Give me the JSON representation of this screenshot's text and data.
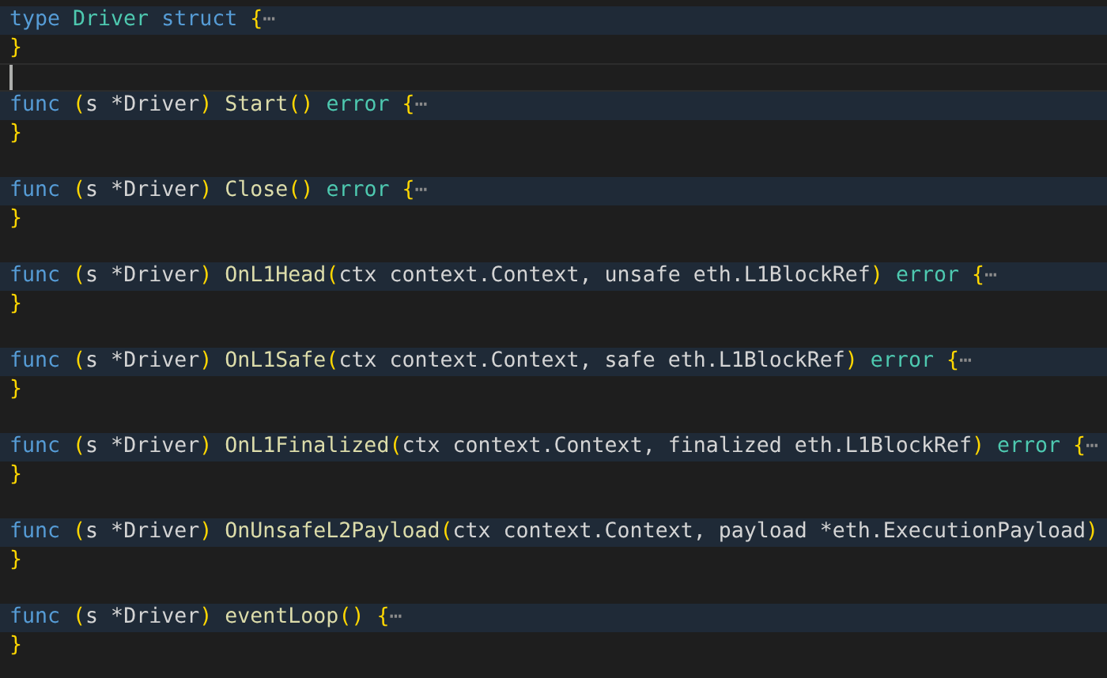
{
  "lines": [
    {
      "folded": true,
      "tokens": [
        {
          "kind": "keyword",
          "text": "type "
        },
        {
          "kind": "type",
          "text": "Driver "
        },
        {
          "kind": "keyword",
          "text": "struct "
        },
        {
          "kind": "bracket",
          "text": "{"
        },
        {
          "kind": "fold",
          "text": "⋯"
        }
      ]
    },
    {
      "folded": false,
      "tokens": [
        {
          "kind": "bracket",
          "text": "}"
        }
      ]
    },
    {
      "folded": false,
      "cursor": true
    },
    {
      "folded": true,
      "tokens": [
        {
          "kind": "keyword",
          "text": "func "
        },
        {
          "kind": "bracket",
          "text": "("
        },
        {
          "kind": "plain",
          "text": "s *Driver"
        },
        {
          "kind": "bracket",
          "text": ") "
        },
        {
          "kind": "func",
          "text": "Start"
        },
        {
          "kind": "bracket",
          "text": "() "
        },
        {
          "kind": "type",
          "text": "error "
        },
        {
          "kind": "bracket",
          "text": "{"
        },
        {
          "kind": "fold",
          "text": "⋯"
        }
      ]
    },
    {
      "folded": false,
      "tokens": [
        {
          "kind": "bracket",
          "text": "}"
        }
      ]
    },
    {
      "folded": false
    },
    {
      "folded": true,
      "tokens": [
        {
          "kind": "keyword",
          "text": "func "
        },
        {
          "kind": "bracket",
          "text": "("
        },
        {
          "kind": "plain",
          "text": "s *Driver"
        },
        {
          "kind": "bracket",
          "text": ") "
        },
        {
          "kind": "func",
          "text": "Close"
        },
        {
          "kind": "bracket",
          "text": "() "
        },
        {
          "kind": "type",
          "text": "error "
        },
        {
          "kind": "bracket",
          "text": "{"
        },
        {
          "kind": "fold",
          "text": "⋯"
        }
      ]
    },
    {
      "folded": false,
      "tokens": [
        {
          "kind": "bracket",
          "text": "}"
        }
      ]
    },
    {
      "folded": false
    },
    {
      "folded": true,
      "tokens": [
        {
          "kind": "keyword",
          "text": "func "
        },
        {
          "kind": "bracket",
          "text": "("
        },
        {
          "kind": "plain",
          "text": "s *Driver"
        },
        {
          "kind": "bracket",
          "text": ") "
        },
        {
          "kind": "func",
          "text": "OnL1Head"
        },
        {
          "kind": "bracket",
          "text": "("
        },
        {
          "kind": "plain",
          "text": "ctx context.Context, unsafe eth.L1BlockRef"
        },
        {
          "kind": "bracket",
          "text": ") "
        },
        {
          "kind": "type",
          "text": "error "
        },
        {
          "kind": "bracket",
          "text": "{"
        },
        {
          "kind": "fold",
          "text": "⋯"
        }
      ]
    },
    {
      "folded": false,
      "tokens": [
        {
          "kind": "bracket",
          "text": "}"
        }
      ]
    },
    {
      "folded": false
    },
    {
      "folded": true,
      "tokens": [
        {
          "kind": "keyword",
          "text": "func "
        },
        {
          "kind": "bracket",
          "text": "("
        },
        {
          "kind": "plain",
          "text": "s *Driver"
        },
        {
          "kind": "bracket",
          "text": ") "
        },
        {
          "kind": "func",
          "text": "OnL1Safe"
        },
        {
          "kind": "bracket",
          "text": "("
        },
        {
          "kind": "plain",
          "text": "ctx context.Context, safe eth.L1BlockRef"
        },
        {
          "kind": "bracket",
          "text": ") "
        },
        {
          "kind": "type",
          "text": "error "
        },
        {
          "kind": "bracket",
          "text": "{"
        },
        {
          "kind": "fold",
          "text": "⋯"
        }
      ]
    },
    {
      "folded": false,
      "tokens": [
        {
          "kind": "bracket",
          "text": "}"
        }
      ]
    },
    {
      "folded": false
    },
    {
      "folded": true,
      "tokens": [
        {
          "kind": "keyword",
          "text": "func "
        },
        {
          "kind": "bracket",
          "text": "("
        },
        {
          "kind": "plain",
          "text": "s *Driver"
        },
        {
          "kind": "bracket",
          "text": ") "
        },
        {
          "kind": "func",
          "text": "OnL1Finalized"
        },
        {
          "kind": "bracket",
          "text": "("
        },
        {
          "kind": "plain",
          "text": "ctx context.Context, finalized eth.L1BlockRef"
        },
        {
          "kind": "bracket",
          "text": ") "
        },
        {
          "kind": "type",
          "text": "error "
        },
        {
          "kind": "bracket",
          "text": "{"
        },
        {
          "kind": "fold",
          "text": "⋯"
        }
      ]
    },
    {
      "folded": false,
      "tokens": [
        {
          "kind": "bracket",
          "text": "}"
        }
      ]
    },
    {
      "folded": false
    },
    {
      "folded": true,
      "tokens": [
        {
          "kind": "keyword",
          "text": "func "
        },
        {
          "kind": "bracket",
          "text": "("
        },
        {
          "kind": "plain",
          "text": "s *Driver"
        },
        {
          "kind": "bracket",
          "text": ") "
        },
        {
          "kind": "func",
          "text": "OnUnsafeL2Payload"
        },
        {
          "kind": "bracket",
          "text": "("
        },
        {
          "kind": "plain",
          "text": "ctx context.Context, payload *eth.ExecutionPayload"
        },
        {
          "kind": "bracket",
          "text": ")"
        }
      ]
    },
    {
      "folded": false,
      "tokens": [
        {
          "kind": "bracket",
          "text": "}"
        }
      ]
    },
    {
      "folded": false
    },
    {
      "folded": true,
      "tokens": [
        {
          "kind": "keyword",
          "text": "func "
        },
        {
          "kind": "bracket",
          "text": "("
        },
        {
          "kind": "plain",
          "text": "s *Driver"
        },
        {
          "kind": "bracket",
          "text": ") "
        },
        {
          "kind": "func",
          "text": "eventLoop"
        },
        {
          "kind": "bracket",
          "text": "() "
        },
        {
          "kind": "bracket",
          "text": "{"
        },
        {
          "kind": "fold",
          "text": "⋯"
        }
      ]
    },
    {
      "folded": false,
      "tokens": [
        {
          "kind": "bracket",
          "text": "}"
        }
      ]
    }
  ]
}
